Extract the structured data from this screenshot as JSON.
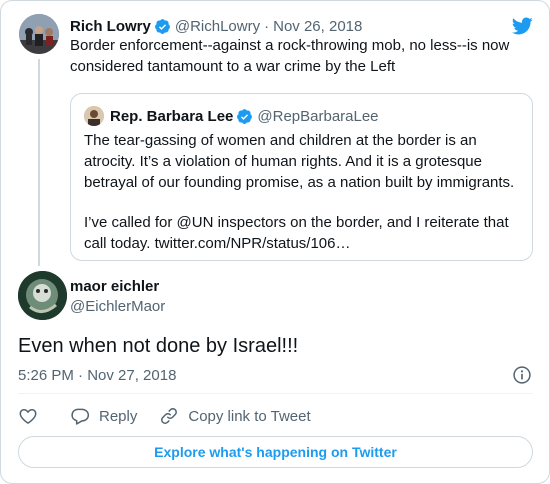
{
  "parent_tweet": {
    "author_name": "Rich Lowry",
    "handle": "@RichLowry",
    "separator": "·",
    "date": "Nov 26, 2018",
    "text": "Border enforcement--against a rock-throwing mob, no less--is now considered tantamount to a war crime by the Left"
  },
  "quoted_tweet": {
    "author_name": "Rep. Barbara Lee",
    "handle": "@RepBarbaraLee",
    "paragraph_1": "The tear-gassing of women and children at the border is an atrocity. It’s a violation of human rights. And it is a grotesque betrayal of our founding promise, as a nation built by immigrants.",
    "paragraph_2": "I’ve called for @UN inspectors on the border, and I reiterate that call today. twitter.com/NPR/status/106…"
  },
  "reply_tweet": {
    "author_name": "maor eichler",
    "handle": "@EichlerMaor",
    "text": "Even when not done by Israel!!!",
    "timestamp": "5:26 PM · Nov 27, 2018"
  },
  "actions": {
    "reply_label": "Reply",
    "copy_link_label": "Copy link to Tweet"
  },
  "explore_button": "Explore what's happening on Twitter",
  "colors": {
    "accent": "#1d9bf0",
    "text": "#0f1419",
    "muted": "#536471",
    "border": "#cfd9de"
  },
  "icons": [
    "verified-badge-icon",
    "twitter-bird-icon",
    "info-icon",
    "heart-icon",
    "reply-icon",
    "link-icon"
  ]
}
